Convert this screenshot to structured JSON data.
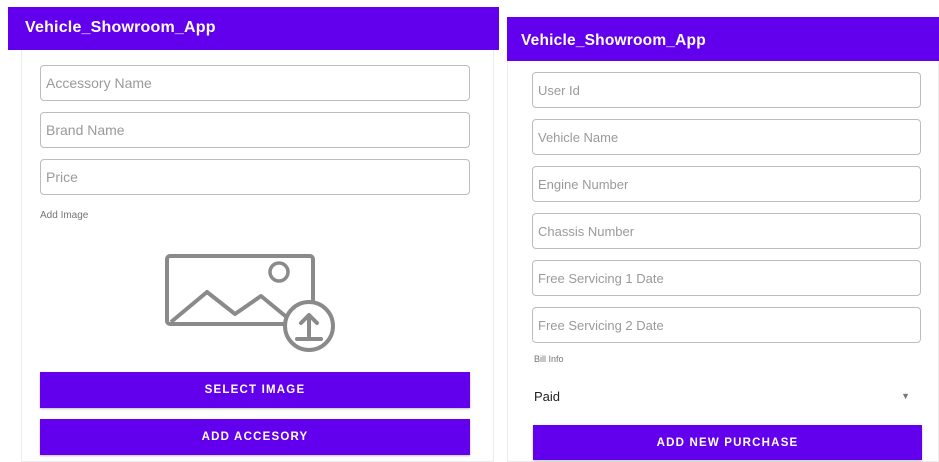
{
  "left_screen": {
    "app_title": "Vehicle_Showroom_App",
    "fields": {
      "accessory_name_placeholder": "Accessory Name",
      "brand_name_placeholder": "Brand Name",
      "price_placeholder": "Price"
    },
    "add_image_label": "Add Image",
    "image_icon": "image-upload-icon",
    "select_image_button": "SELECT IMAGE",
    "add_accessory_button": "ADD ACCESORY"
  },
  "right_screen": {
    "app_title": "Vehicle_Showroom_App",
    "fields": {
      "user_id_placeholder": "User Id",
      "vehicle_name_placeholder": "Vehicle Name",
      "engine_number_placeholder": "Engine Number",
      "chassis_number_placeholder": "Chassis Number",
      "free_servicing_1_placeholder": "Free Servicing 1 Date",
      "free_servicing_2_placeholder": "Free Servicing 2 Date"
    },
    "bill_info_label": "Bill Info",
    "bill_status_selected": "Paid",
    "dropdown_icon": "caret-down-icon",
    "add_purchase_button": "ADD NEW PURCHASE"
  },
  "colors": {
    "primary": "#6200ee",
    "on_primary": "#ffffff",
    "field_border": "#bdbdbd",
    "hint_text": "#9a9a9a"
  }
}
